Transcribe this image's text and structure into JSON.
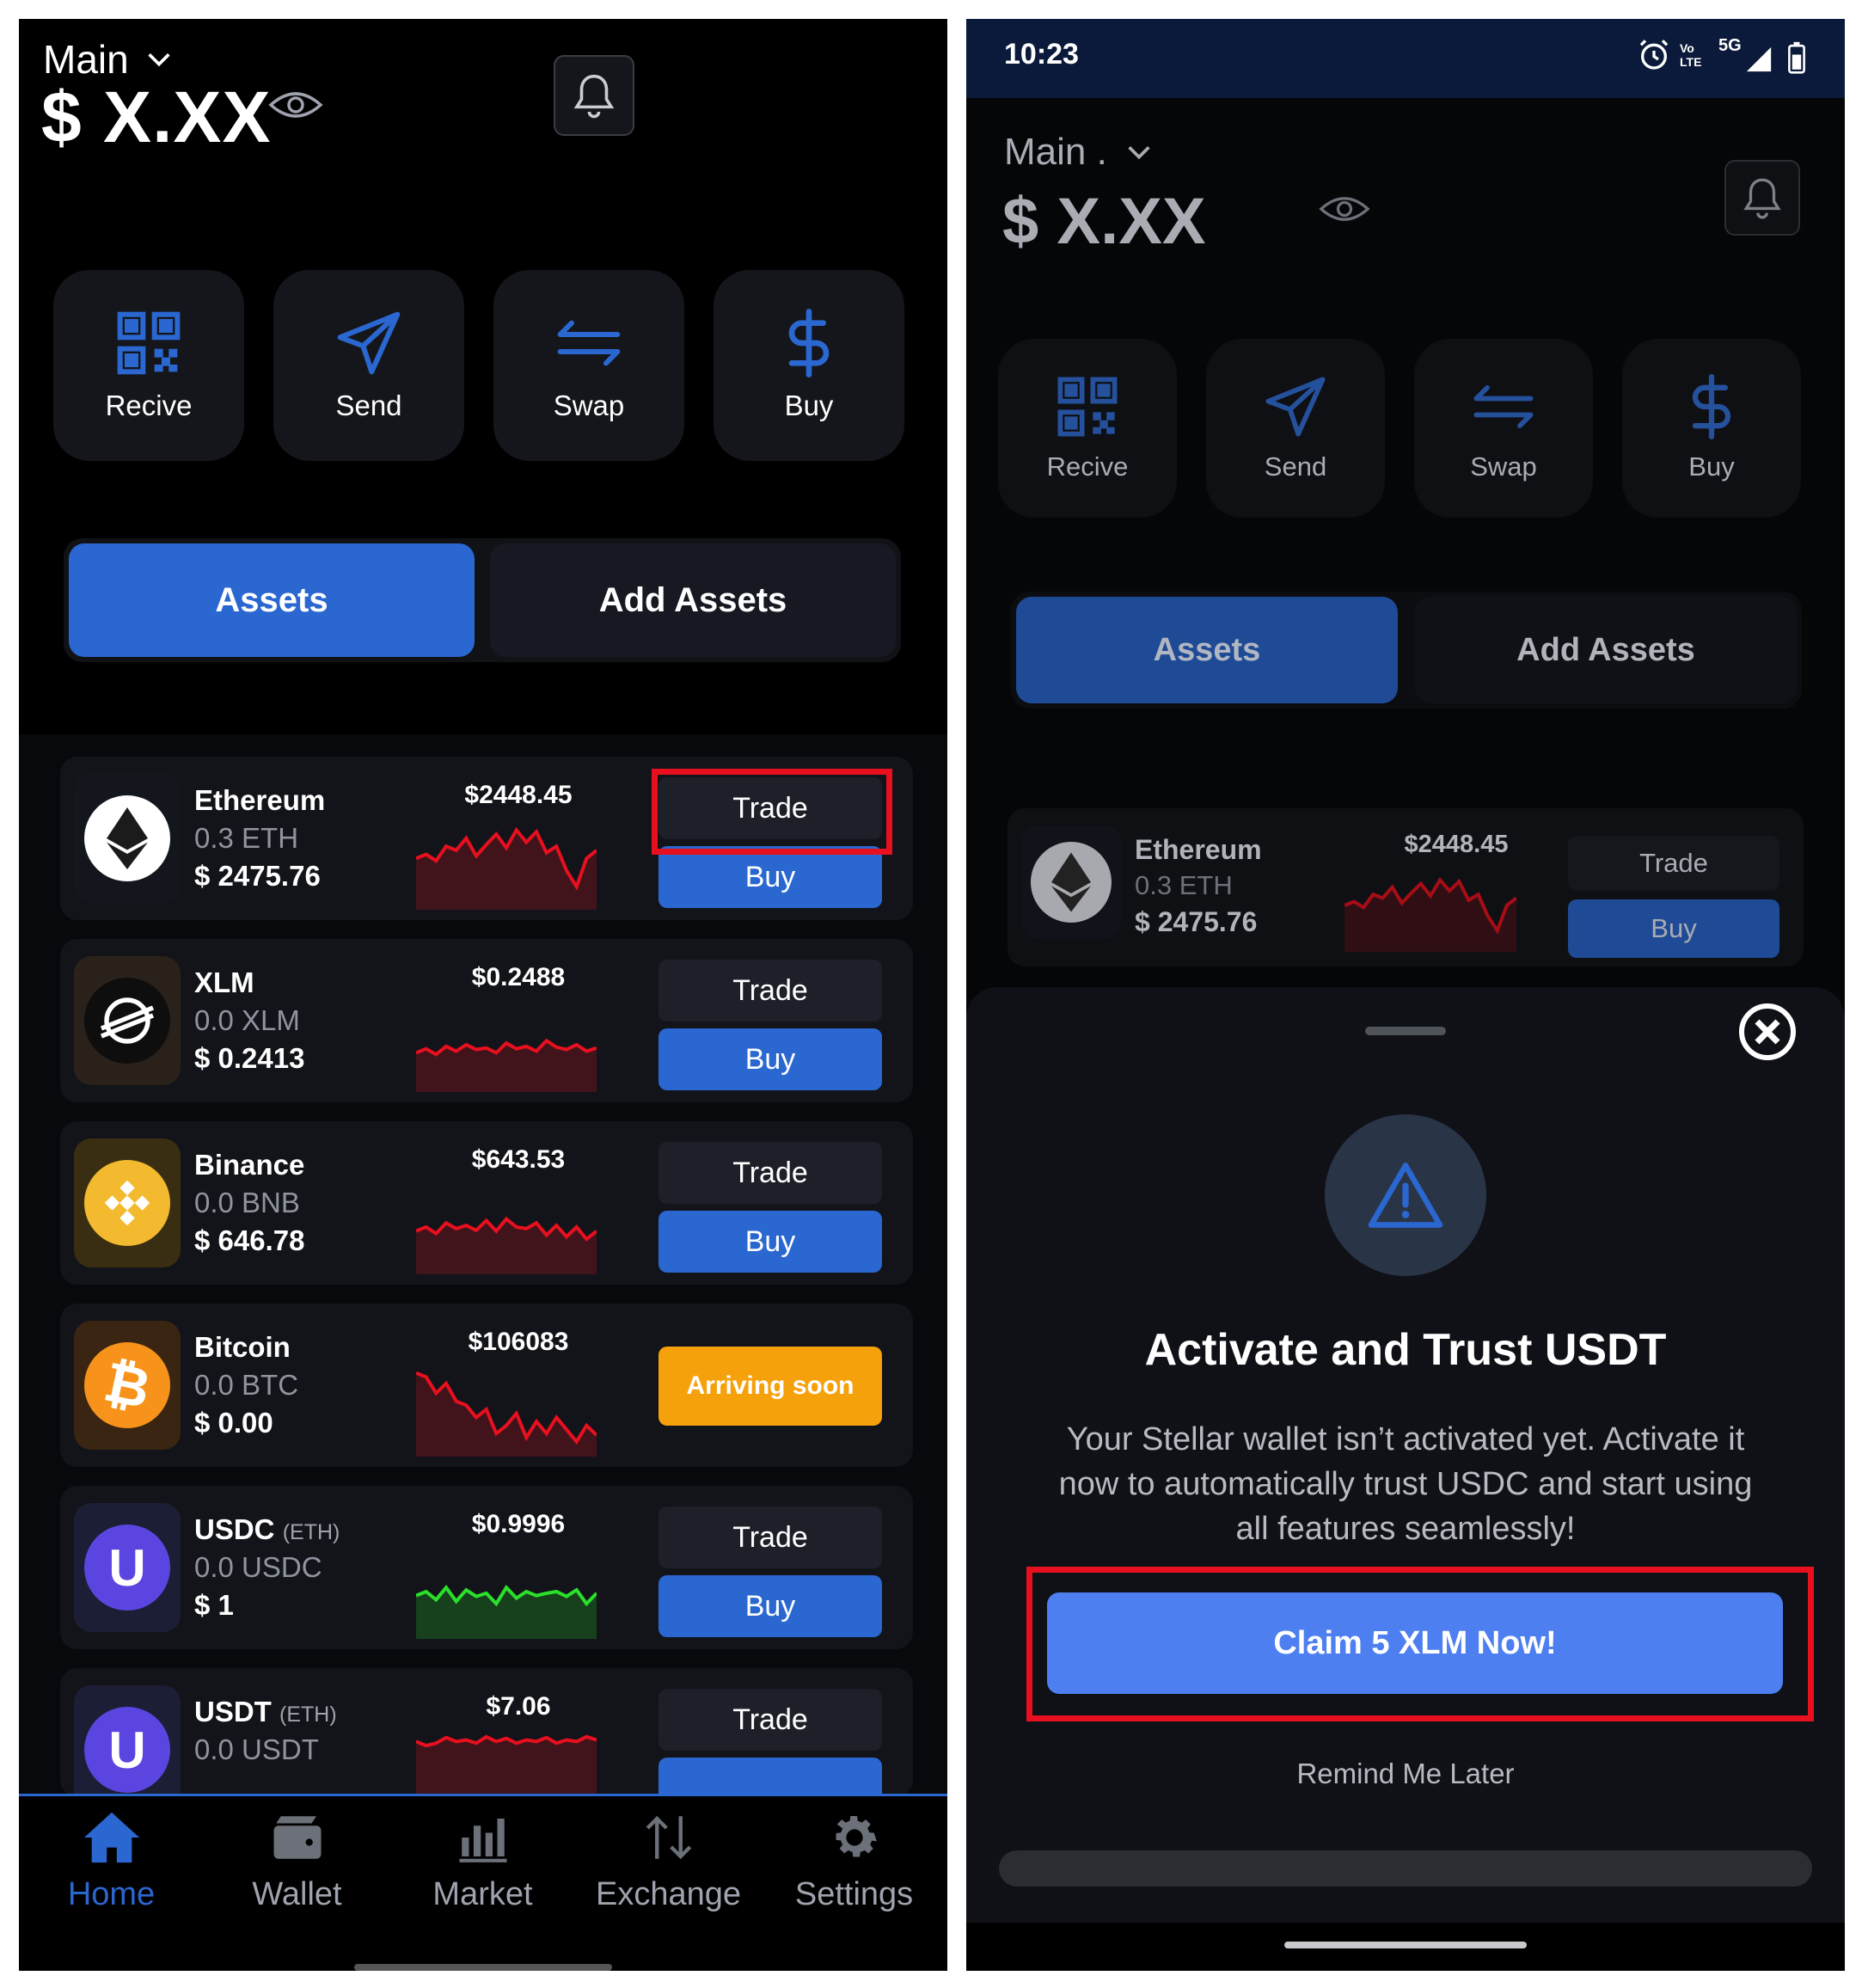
{
  "left": {
    "header": {
      "account": "Main",
      "balance": "$ X.XX"
    },
    "actions": [
      {
        "label": "Recive",
        "icon": "qr-code-icon"
      },
      {
        "label": "Send",
        "icon": "send-icon"
      },
      {
        "label": "Swap",
        "icon": "swap-icon"
      },
      {
        "label": "Buy",
        "icon": "dollar-icon"
      }
    ],
    "tabs": {
      "assets": "Assets",
      "add_assets": "Add Assets"
    },
    "assets": [
      {
        "name": "Ethereum",
        "suffix": "",
        "balance": "0.3 ETH",
        "value": "$ 2475.76",
        "price": "$2448.45",
        "trade": "Trade",
        "buy": "Buy",
        "trend": "down"
      },
      {
        "name": "XLM",
        "suffix": "",
        "balance": "0.0 XLM",
        "value": "$ 0.2413",
        "price": "$0.2488",
        "trade": "Trade",
        "buy": "Buy",
        "trend": "down"
      },
      {
        "name": "Binance",
        "suffix": "",
        "balance": "0.0 BNB",
        "value": "$ 646.78",
        "price": "$643.53",
        "trade": "Trade",
        "buy": "Buy",
        "trend": "down"
      },
      {
        "name": "Bitcoin",
        "suffix": "",
        "balance": "0.0 BTC",
        "value": "$ 0.00",
        "price": "$106083",
        "arriving": "Arriving soon",
        "trend": "down"
      },
      {
        "name": "USDC",
        "suffix": "(ETH)",
        "balance": "0.0 USDC",
        "value": "$ 1",
        "price": "$0.9996",
        "trade": "Trade",
        "buy": "Buy",
        "trend": "up"
      },
      {
        "name": "USDT",
        "suffix": "(ETH)",
        "balance": "0.0 USDT",
        "value": "",
        "price": "$7.06",
        "trade": "Trade",
        "buy": "",
        "trend": "down"
      }
    ],
    "nav": [
      {
        "label": "Home",
        "icon": "home-icon",
        "active": true
      },
      {
        "label": "Wallet",
        "icon": "wallet-icon",
        "active": false
      },
      {
        "label": "Market",
        "icon": "market-icon",
        "active": false
      },
      {
        "label": "Exchange",
        "icon": "exchange-icon",
        "active": false
      },
      {
        "label": "Settings",
        "icon": "settings-icon",
        "active": false
      }
    ]
  },
  "right": {
    "status_bar": {
      "time": "10:23",
      "network": "5G",
      "volte": "Vo LTE"
    },
    "header": {
      "account": "Main .",
      "balance": "$ X.XX"
    },
    "actions": [
      {
        "label": "Recive",
        "icon": "qr-code-icon"
      },
      {
        "label": "Send",
        "icon": "send-icon"
      },
      {
        "label": "Swap",
        "icon": "swap-icon"
      },
      {
        "label": "Buy",
        "icon": "dollar-icon"
      }
    ],
    "tabs": {
      "assets": "Assets",
      "add_assets": "Add Assets"
    },
    "asset": {
      "name": "Ethereum",
      "balance": "0.3 ETH",
      "value": "$ 2475.76",
      "price": "$2448.45",
      "trade": "Trade",
      "buy": "Buy"
    },
    "sheet": {
      "title": "Activate and Trust USDT",
      "body_lines": [
        "Your Stellar wallet isn’t activated yet. Activate it",
        "now to automatically trust USDC and start using",
        "all features seamlessly!"
      ],
      "claim": "Claim 5 XLM Now!",
      "remind": "Remind Me Later"
    }
  },
  "colors": {
    "accent": "#2a67d0",
    "highlight": "#e8101e",
    "arriving": "#f5a10c",
    "down": "#e8101e",
    "up": "#2be02b"
  }
}
